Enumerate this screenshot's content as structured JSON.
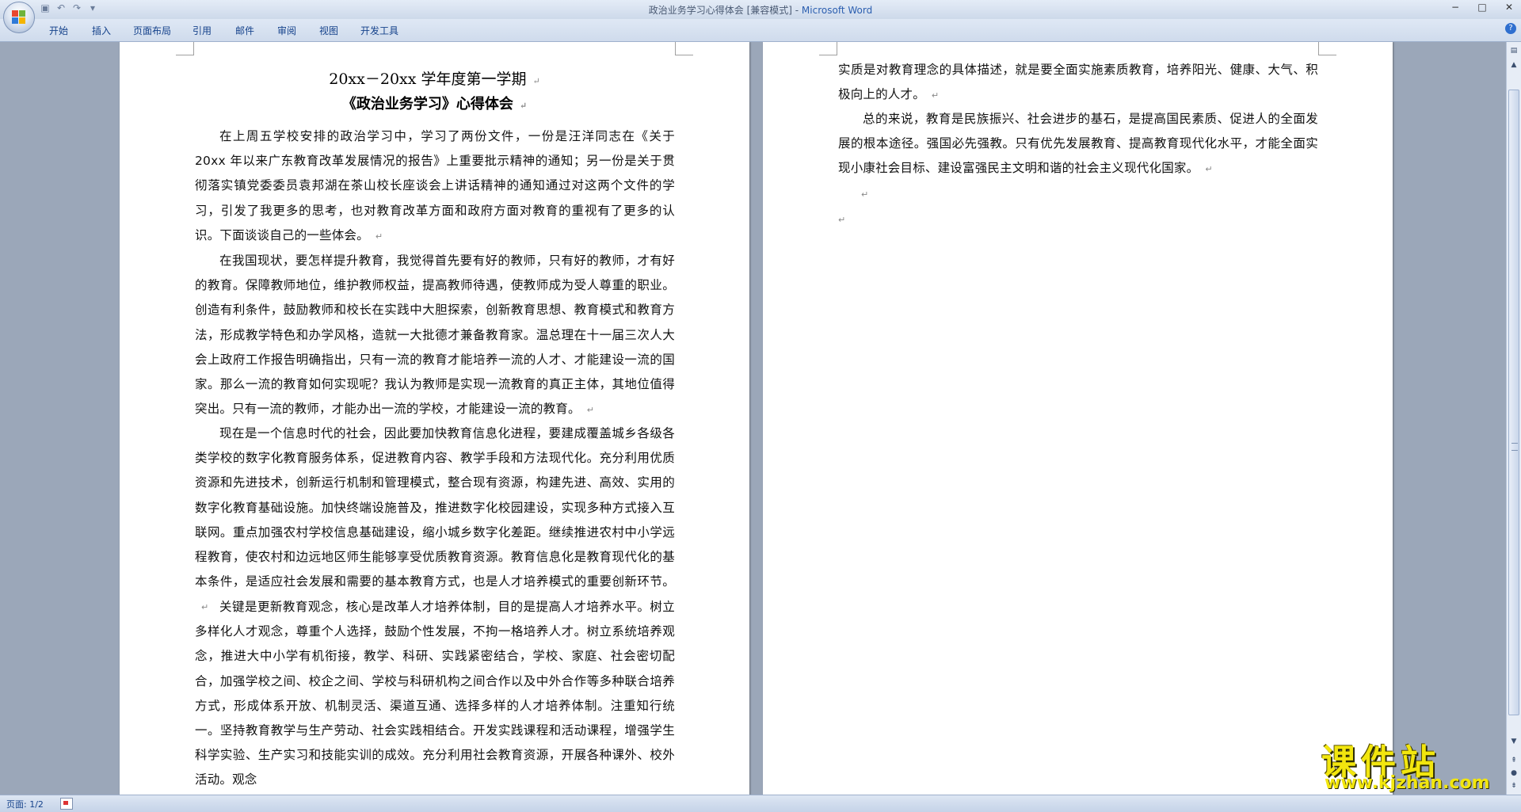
{
  "window": {
    "title_doc": "政治业务学习心得体会 [兼容模式] - ",
    "title_app": "Microsoft Word",
    "controls": [
      "−",
      "□",
      "✕"
    ]
  },
  "quick_access": [
    "save-icon",
    "undo-icon",
    "redo-icon",
    "customize-icon"
  ],
  "ribbon": {
    "tabs": [
      "开始",
      "插入",
      "页面布局",
      "引用",
      "邮件",
      "审阅",
      "视图",
      "开发工具"
    ],
    "help": "?"
  },
  "page1": {
    "title": "20xx－20xx 学年度第一学期",
    "subtitle": "《政治业务学习》心得体会",
    "paragraphs": [
      "在上周五学校安排的政治学习中，学习了两份文件，一份是汪洋同志在《关于 20xx 年以来广东教育改革发展情况的报告》上重要批示精神的通知；另一份是关于贯彻落实镇党委委员袁邦湖在茶山校长座谈会上讲话精神的通知通过对这两个文件的学习，引发了我更多的思考，也对教育改革方面和政府方面对教育的重视有了更多的认识。下面谈谈自己的一些体会。",
      "在我国现状，要怎样提升教育，我觉得首先要有好的教师，只有好的教师，才有好的教育。保障教师地位，维护教师权益，提高教师待遇，使教师成为受人尊重的职业。创造有利条件，鼓励教师和校长在实践中大胆探索，创新教育思想、教育模式和教育方法，形成教学特色和办学风格，造就一大批德才兼备教育家。温总理在十一届三次人大会上政府工作报告明确指出，只有一流的教育才能培养一流的人才、才能建设一流的国家。那么一流的教育如何实现呢？我认为教师是实现一流教育的真正主体，其地位值得突出。只有一流的教师，才能办出一流的学校，才能建设一流的教育。",
      "现在是一个信息时代的社会，因此要加快教育信息化进程，要建成覆盖城乡各级各类学校的数字化教育服务体系，促进教育内容、教学手段和方法现代化。充分利用优质资源和先进技术，创新运行机制和管理模式，整合现有资源，构建先进、高效、实用的数字化教育基础设施。加快终端设施普及，推进数字化校园建设，实现多种方式接入互联网。重点加强农村学校信息基础建设，缩小城乡数字化差距。继续推进农村中小学远程教育，使农村和边远地区师生能够享受优质教育资源。教育信息化是教育现代化的基本条件，是适应社会发展和需要的基本教育方式，也是人才培养模式的重要创新环节。",
      "关键是更新教育观念，核心是改革人才培养体制，目的是提高人才培养水平。树立多样化人才观念，尊重个人选择，鼓励个性发展，不拘一格培养人才。树立系统培养观念，推进大中小学有机衔接，教学、科研、实践紧密结合，学校、家庭、社会密切配合，加强学校之间、校企之间、学校与科研机构之间合作以及中外合作等多种联合培养方式，形成体系开放、机制灵活、渠道互通、选择多样的人才培养体制。注重知行统一。坚持教育教学与生产劳动、社会实践相结合。开发实践课程和活动课程，增强学生科学实验、生产实习和技能实训的成效。充分利用社会教育资源，开展各种课外、校外活动。观念"
    ]
  },
  "page2": {
    "paragraphs": [
      "实质是对教育理念的具体描述，就是要全面实施素质教育，培养阳光、健康、大气、积极向上的人才。",
      "总的来说，教育是民族振兴、社会进步的基石，是提高国民素质、促进人的全面发展的根本途径。强国必先强教。只有优先发展教育、提高教育现代化水平，才能全面实现小康社会目标、建设富强民主文明和谐的社会主义现代化国家。"
    ]
  },
  "paragraph_mark": "↵",
  "status": {
    "page": "页面: 1/2"
  },
  "watermark": {
    "cn": "课件站",
    "url": "www.kjzhan.com"
  }
}
